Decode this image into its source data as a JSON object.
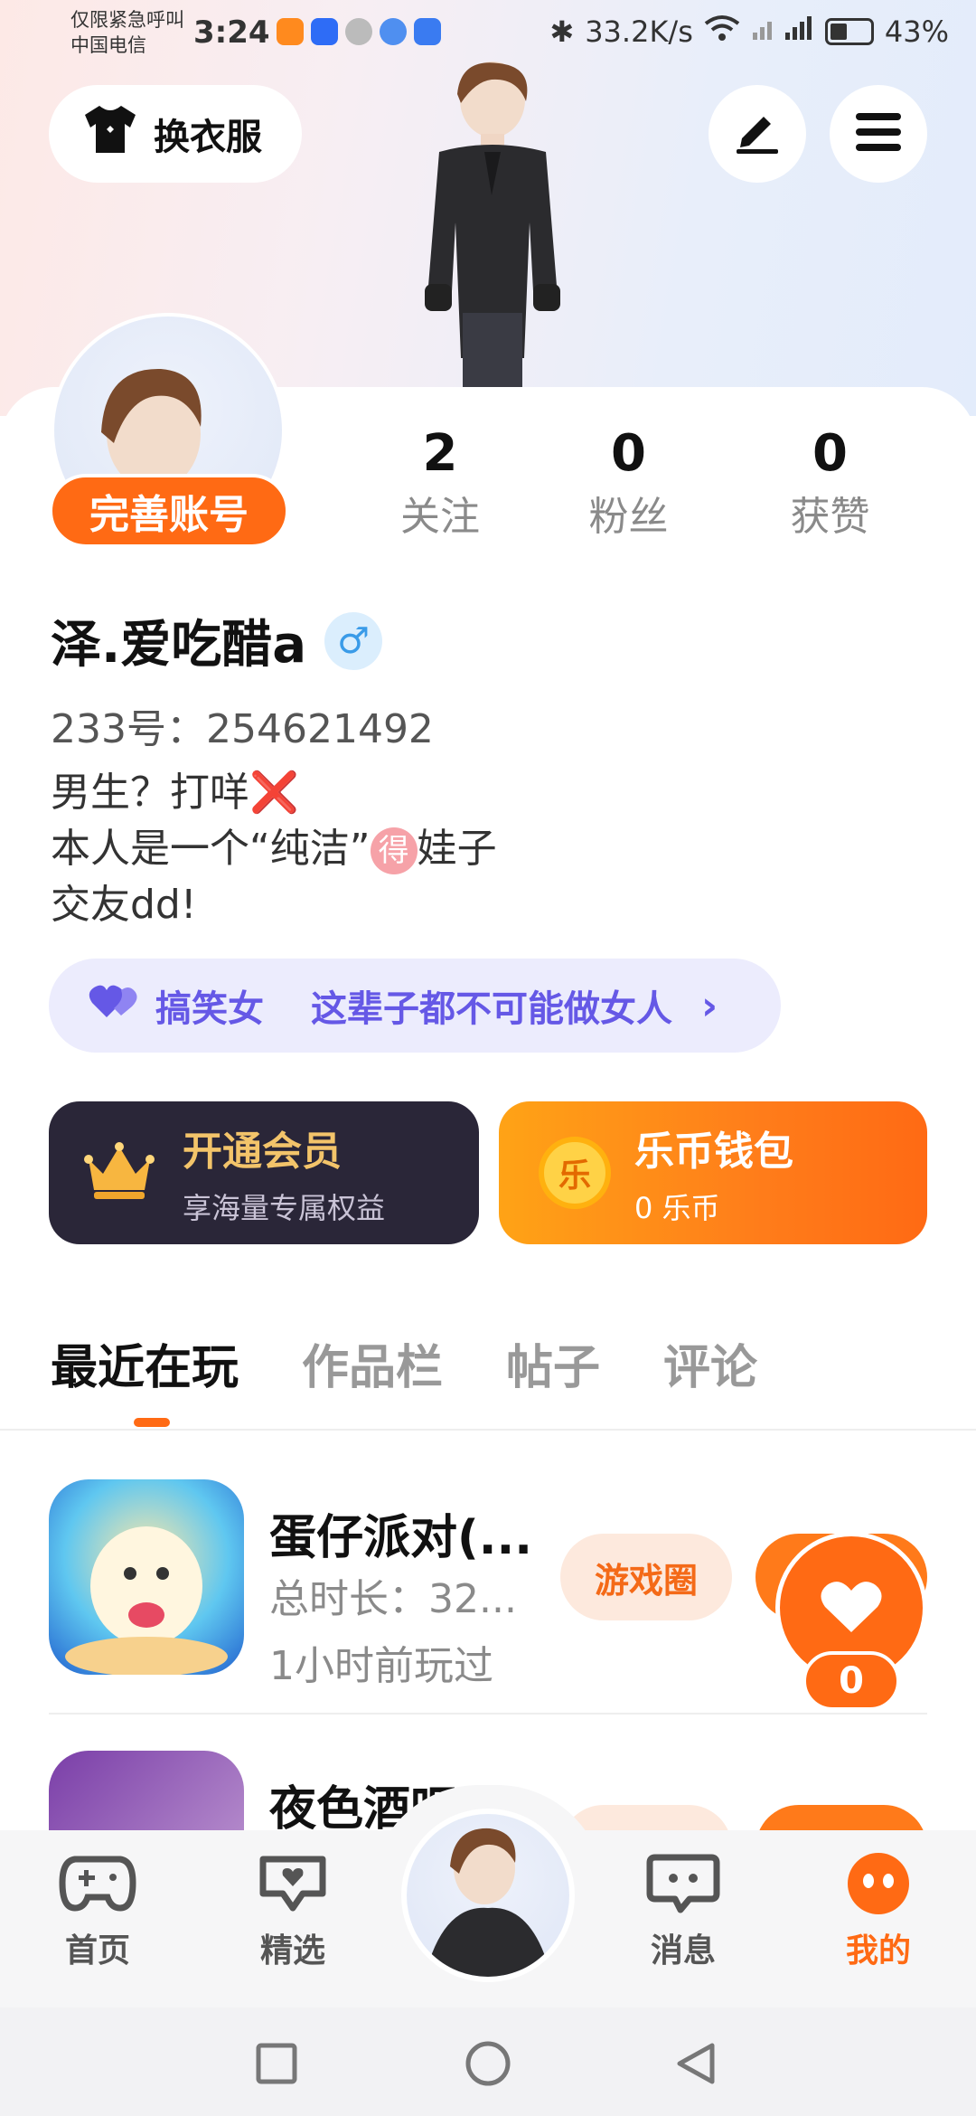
{
  "status_bar": {
    "carrier_line1": "仅限紧急呼叫",
    "carrier_line2": "中国电信",
    "time": "3:24",
    "network_speed": "33.2K/s",
    "battery": "43%"
  },
  "header": {
    "outfit_label": "换衣服"
  },
  "profile": {
    "complete_label": "完善账号",
    "stats": [
      {
        "value": "2",
        "label": "关注"
      },
      {
        "value": "0",
        "label": "粉丝"
      },
      {
        "value": "0",
        "label": "获赞"
      }
    ],
    "name": "泽.爱吃醋a",
    "gender_symbol": "♂",
    "uid": "233号：254621492",
    "bio_line1_text": "男生？打咩",
    "bio_line1_mark": "❌",
    "bio_line2_a": "本人是一个“纯洁”",
    "bio_line2_circle": "得",
    "bio_line2_b": "娃子",
    "bio_line3": "交友dd!",
    "tag_1": "搞笑女",
    "tag_2": "这辈子都不可能做女人",
    "tag_chevron": "›"
  },
  "cards": {
    "vip_title": "开通会员",
    "vip_sub": "享海量专属权益",
    "wallet_title": "乐币钱包",
    "wallet_sub": "0 乐币",
    "coin_glyph": "乐"
  },
  "tabs": [
    "最近在玩",
    "作品栏",
    "帖子",
    "评论"
  ],
  "games": [
    {
      "title": "蛋仔派对(...",
      "meta": "总时长：32...",
      "time": "1小时前玩过",
      "circle_label": "游戏圈"
    },
    {
      "title": "夜色酒吧",
      "meta": "",
      "time": "",
      "circle_label": ""
    }
  ],
  "like_count": "0",
  "bottom_nav": [
    {
      "label": "首页",
      "icon": "gamepad-icon"
    },
    {
      "label": "精选",
      "icon": "heart-chat-icon"
    },
    {
      "label": "消息",
      "icon": "chat-bubble-icon"
    },
    {
      "label": "我的",
      "icon": "smile-face-icon"
    }
  ],
  "colors": {
    "accent": "#ff6a14",
    "tag_purple": "#6558e6",
    "vip_dark": "#2a2638"
  }
}
